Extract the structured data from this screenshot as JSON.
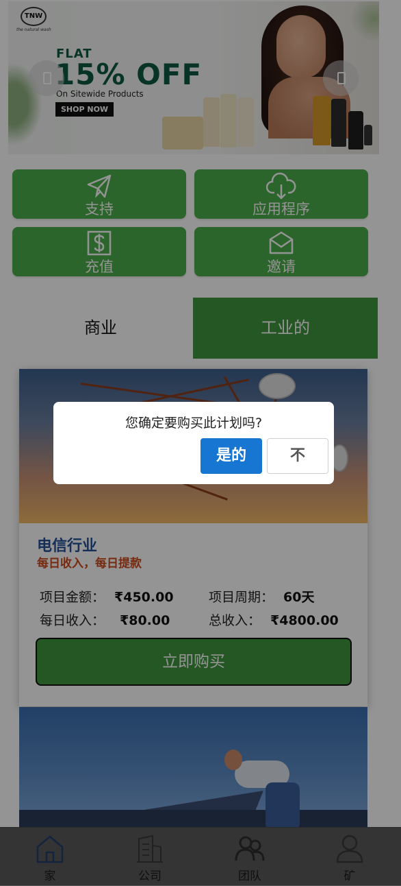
{
  "banner": {
    "brand_name": "TNW",
    "brand_tagline": "the natural wash",
    "promo_flat": "FLAT",
    "promo_offer": "15% OFF",
    "promo_sub": "On Sitewide Products",
    "shop_now": "SHOP NOW",
    "prev_icon": "chevron-left-icon",
    "next_icon": "chevron-right-icon"
  },
  "quick_actions": [
    {
      "label": "支持",
      "icon": "paper-plane-icon"
    },
    {
      "label": "应用程序",
      "icon": "cloud-download-icon"
    },
    {
      "label": "充值",
      "icon": "dollar-box-icon"
    },
    {
      "label": "邀请",
      "icon": "envelope-icon"
    }
  ],
  "tabs": [
    {
      "label": "商业",
      "active": false
    },
    {
      "label": "工业的",
      "active": true
    }
  ],
  "product": {
    "title": "电信行业",
    "subtitle": "每日收入，每日提款",
    "amount_label": "项目金额：",
    "amount_value": "₹450.00",
    "period_label": "项目周期：",
    "period_value": "60天",
    "daily_label": "每日收入：",
    "daily_value": "₹80.00",
    "total_label": "总收入：",
    "total_value": "₹4800.00",
    "buy_label": "立即购买"
  },
  "modal": {
    "message": "您确定要购买此计划吗?",
    "confirm": "是的",
    "cancel": "不"
  },
  "bottom_nav": [
    {
      "label": "家",
      "icon": "home-icon",
      "active": true
    },
    {
      "label": "公司",
      "icon": "building-icon",
      "active": false
    },
    {
      "label": "团队",
      "icon": "team-icon",
      "active": false
    },
    {
      "label": "矿",
      "icon": "user-icon",
      "active": false
    }
  ],
  "colors": {
    "green": "#4cae4c",
    "tab_active": "#3f963f",
    "title_blue": "#26529a",
    "subtitle_red": "#cc4b1e",
    "confirm_blue": "#1676d2"
  }
}
